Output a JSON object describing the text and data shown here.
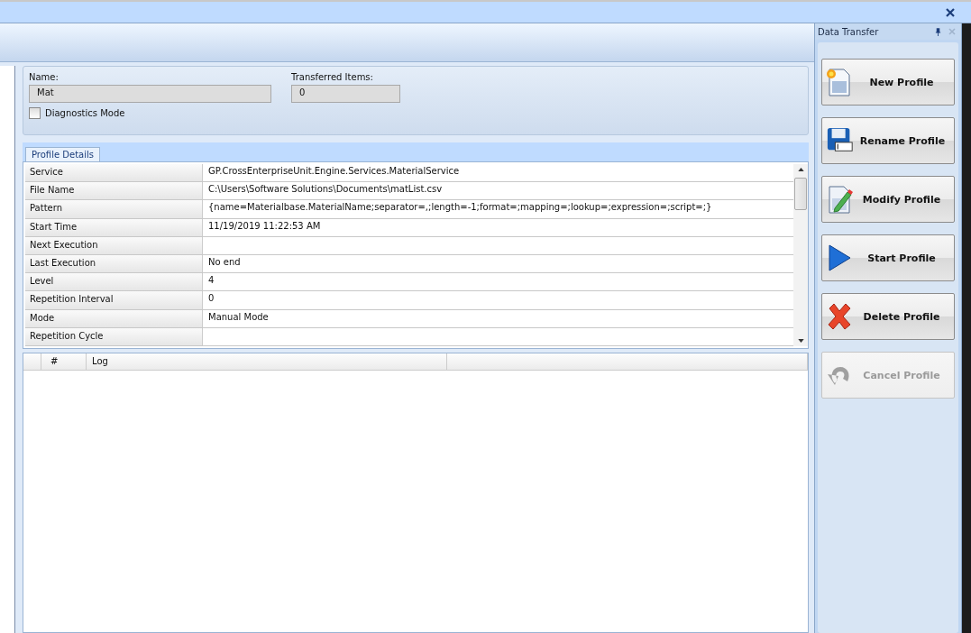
{
  "form": {
    "name_label": "Name:",
    "name_value": "Mat",
    "items_label": "Transferred Items:",
    "items_value": "0",
    "diagnostics": {
      "label": "Diagnostics Mode",
      "checked": false
    }
  },
  "tabs": [
    {
      "label": "Profile Details",
      "selected": true
    }
  ],
  "properties": [
    {
      "name": "Service",
      "value": "GP.CrossEnterpriseUnit.Engine.Services.MaterialService"
    },
    {
      "name": "File Name",
      "value": "C:\\Users\\Software Solutions\\Documents\\matList.csv"
    },
    {
      "name": "Pattern",
      "value": "{name=Materialbase.MaterialName;separator=,;length=-1;format=;mapping=;lookup=;expression=;script=;}"
    },
    {
      "name": "Start Time",
      "value": "11/19/2019 11:22:53 AM"
    },
    {
      "name": "Next Execution"
    },
    {
      "name": "Last Execution",
      "value": "No end"
    },
    {
      "name": "Level",
      "value": "4"
    },
    {
      "name": "Repetition Interval",
      "value": "0"
    },
    {
      "name": "Mode",
      "value": "Manual Mode"
    },
    {
      "name": "Repetition Cycle"
    }
  ],
  "log": {
    "columns": [
      "#",
      "Log"
    ]
  },
  "panel": {
    "title": "Data Transfer"
  },
  "actions": [
    {
      "kind": "new",
      "label": "New Profile",
      "disabled": false
    },
    {
      "kind": "rename",
      "label": "Rename Profile",
      "disabled": false
    },
    {
      "kind": "modify",
      "label": "Modify Profile",
      "disabled": false
    },
    {
      "kind": "start",
      "label": "Start Profile",
      "disabled": false
    },
    {
      "kind": "delete",
      "label": "Delete Profile",
      "disabled": false
    },
    {
      "kind": "cancel",
      "label": "Cancel Profile",
      "disabled": true
    }
  ]
}
